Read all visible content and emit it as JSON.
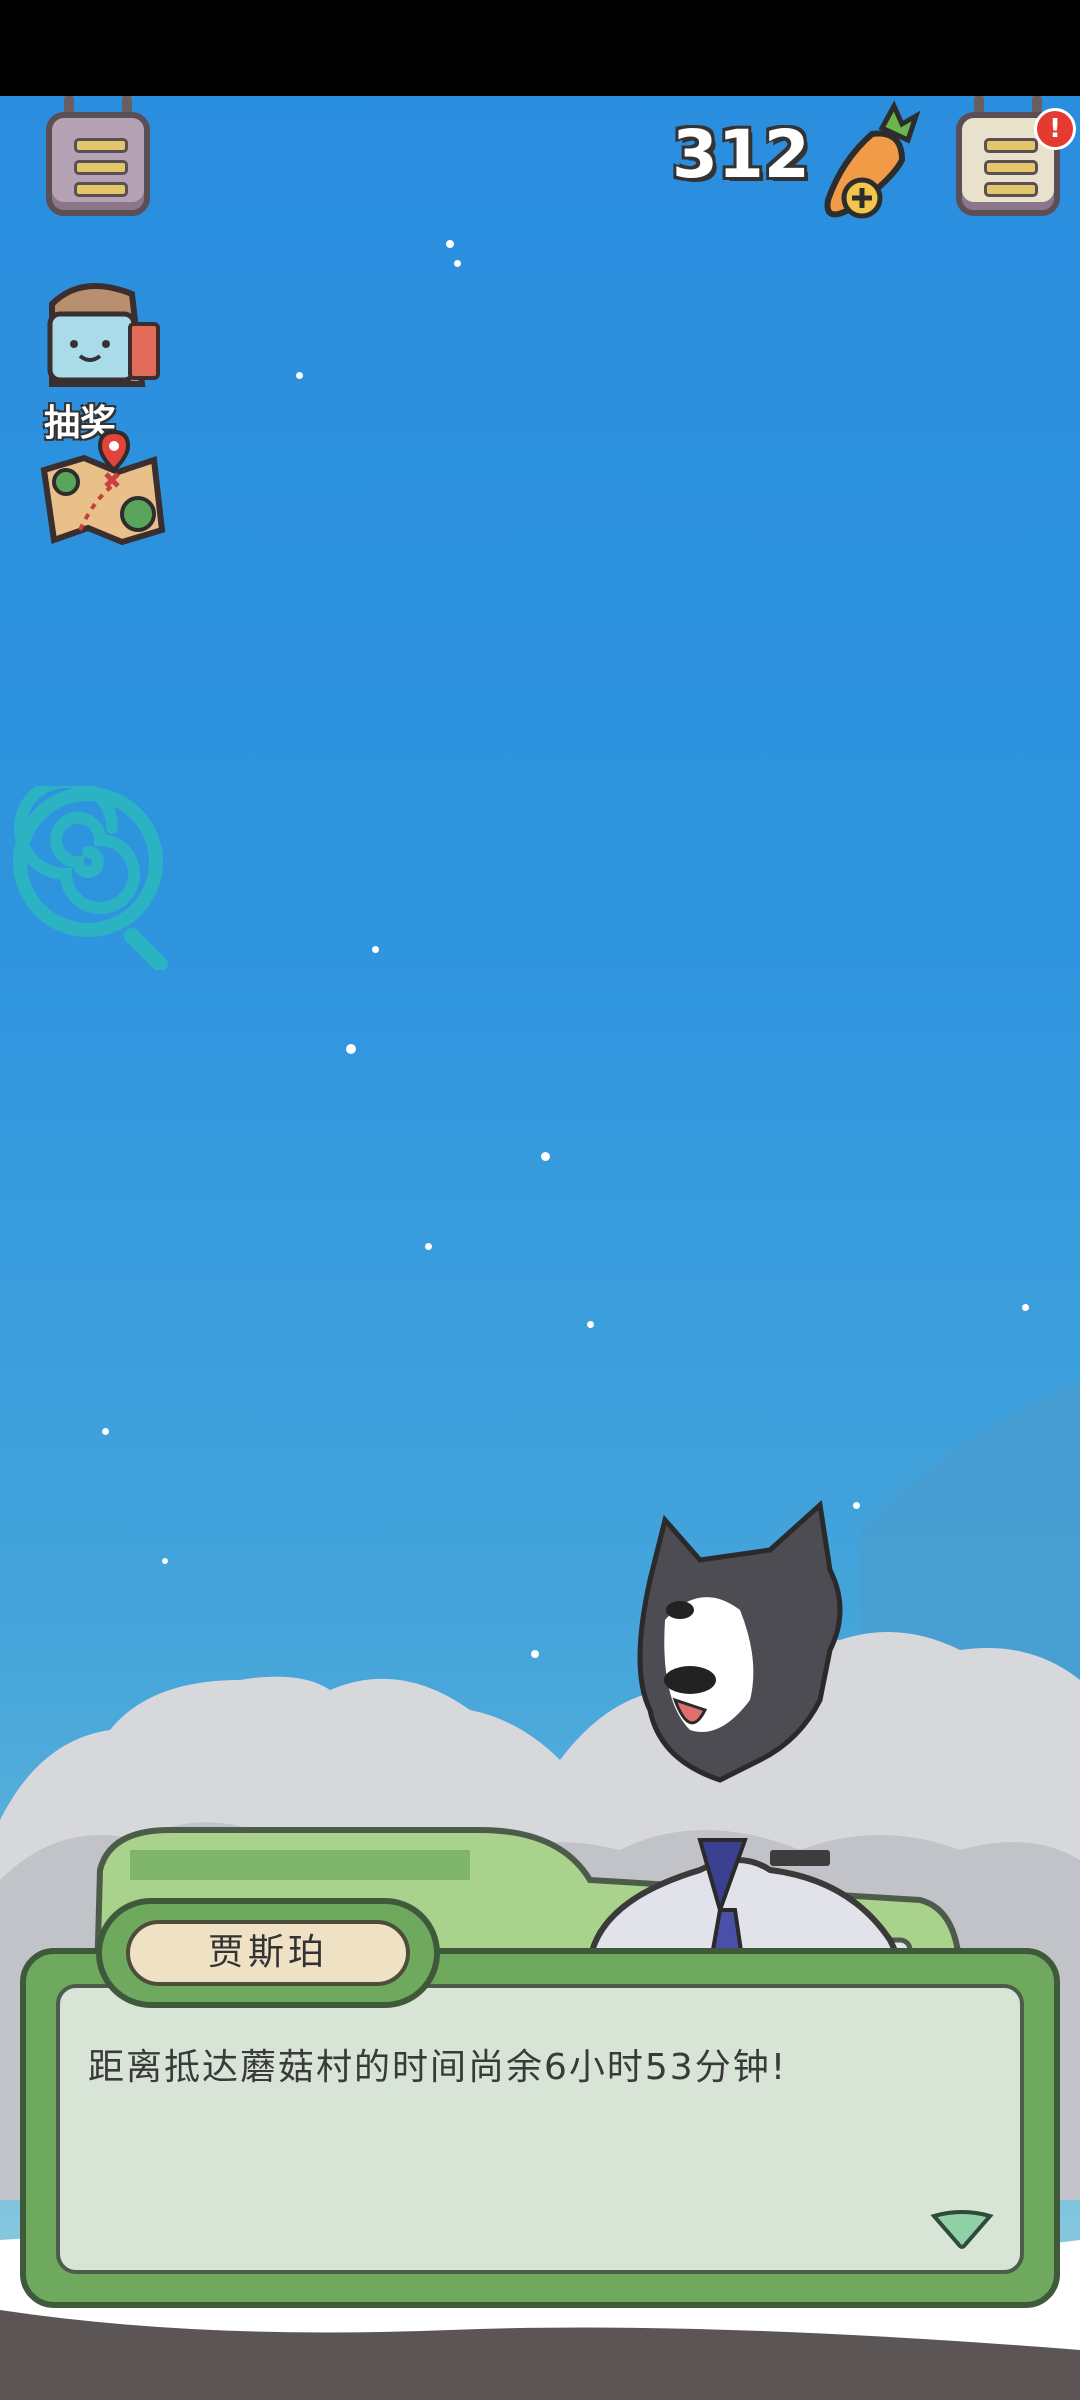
{
  "hud": {
    "coin_count": "312",
    "notification_badge": "!"
  },
  "side_menu": {
    "lottery_label": "抽奖"
  },
  "dialog": {
    "speaker_name": "贾斯珀",
    "message": "距离抵达蘑菇村的时间尚余6小时53分钟!"
  },
  "colors": {
    "sky_top": "#2a8ddf",
    "dialog_frame": "#6ea95e",
    "name_plate": "#efe2c4"
  },
  "icons": [
    "menu-icon",
    "carrot-icon",
    "lottery-box-icon",
    "treasure-map-icon",
    "spiral-lollipop-icon",
    "notebook-icon",
    "continue-arrow-icon"
  ]
}
